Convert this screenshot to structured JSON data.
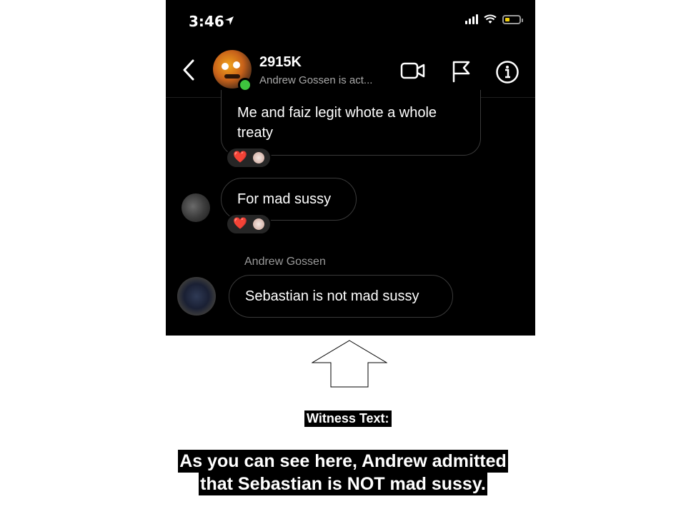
{
  "status_bar": {
    "time": "3:46",
    "location_icon": "location-arrow-icon",
    "signal_icon": "cellular-signal-icon",
    "wifi_icon": "wifi-icon",
    "battery_icon": "battery-low-icon",
    "battery_color": "#f2cf0b"
  },
  "header": {
    "back_icon": "chevron-left-icon",
    "contact_name": "2915K",
    "contact_status": "Andrew Gossen is act...",
    "online_color": "#3ec43e",
    "video_icon": "video-camera-icon",
    "flag_icon": "flag-icon",
    "info_icon": "info-icon"
  },
  "messages": [
    {
      "text_line1": "Me and faiz legit whote a whole",
      "text_line2": "treaty",
      "reactions": [
        "heart",
        "face"
      ]
    },
    {
      "text": "For mad sussy",
      "reactions": [
        "heart",
        "face"
      ]
    },
    {
      "sender": "Andrew Gossen",
      "text": "Sebastian is not mad sussy"
    }
  ],
  "reaction_heart": "❤️",
  "annotation": {
    "arrow_icon": "up-arrow-outline-icon",
    "witness_label": "Witness Text:",
    "caption_line1": "As you can see here, Andrew admitted",
    "caption_line2": "that Sebastian is NOT mad sussy."
  }
}
